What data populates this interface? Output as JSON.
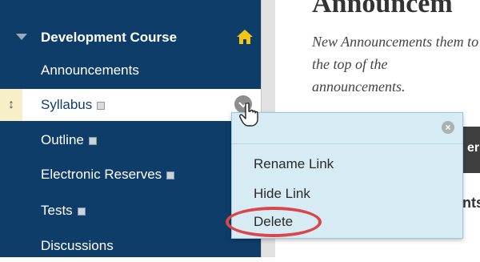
{
  "sidebar": {
    "course_title": "Development Course",
    "items": [
      {
        "label": "Announcements",
        "doc_icon": false
      },
      {
        "label": "Syllabus",
        "doc_icon": true,
        "selected": true
      },
      {
        "label": "Outline",
        "doc_icon": true
      },
      {
        "label": "Electronic Reserves",
        "doc_icon": true
      },
      {
        "label": "Tests",
        "doc_icon": true
      },
      {
        "label": "Discussions",
        "doc_icon": false
      }
    ],
    "drag_handle_symbol": "↕"
  },
  "main": {
    "title_fragment": "Announcem",
    "description_fragment": "New Announcements them to the top of the announcements.",
    "tab_fragment": "er",
    "bg_fragment": "nts"
  },
  "context_menu": {
    "close_symbol": "×",
    "items": [
      {
        "label": "Rename Link"
      },
      {
        "label": "Hide Link"
      },
      {
        "label": "Delete"
      }
    ]
  },
  "colors": {
    "sidebar_bg": "#0f3d6a",
    "menu_bg": "#d7ebf4",
    "highlight_ring": "#d9474b"
  },
  "icons": {
    "home": "home-icon",
    "collapse": "caret-down-icon",
    "doc": "document-icon",
    "chevron": "chevron-down-icon",
    "close": "close-icon",
    "cursor": "hand-cursor-icon"
  }
}
